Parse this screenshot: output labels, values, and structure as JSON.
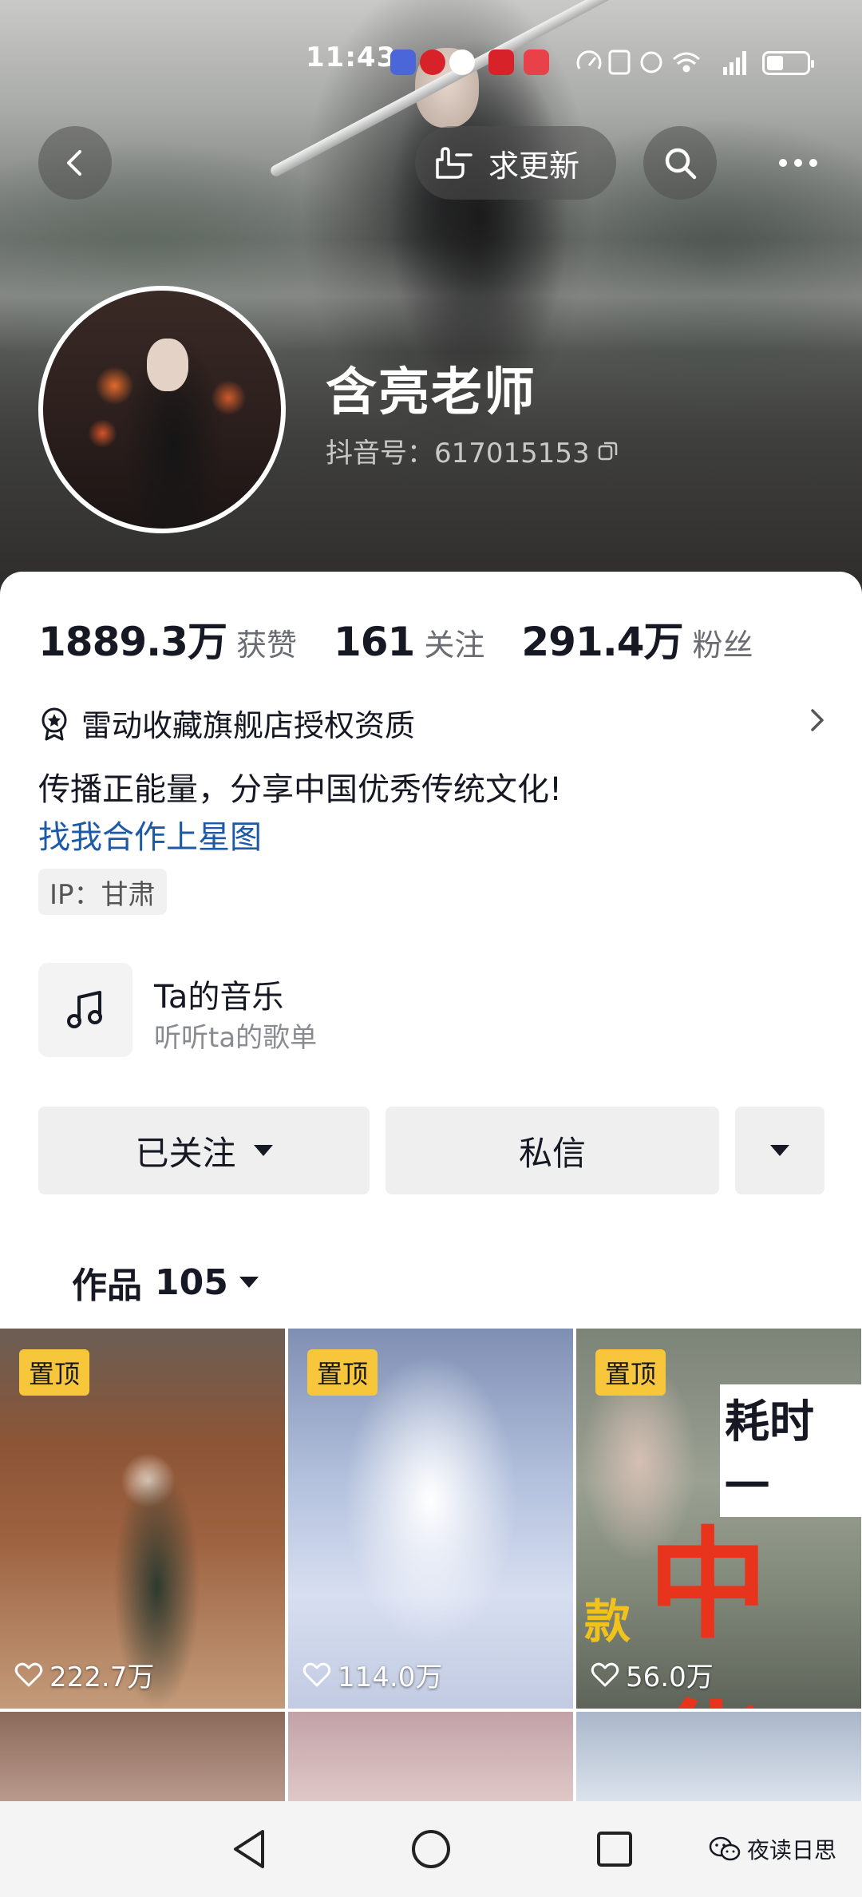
{
  "status_bar": {
    "time": "11:43",
    "app_icon_colors": [
      "#4a66d9",
      "#d8222a",
      "#2f7be6",
      "#d8222a",
      "#e8414a"
    ],
    "icons": [
      "speed-icon",
      "nfc-icon",
      "alarm-icon",
      "wifi-icon",
      "signal-5g-icon",
      "battery-icon"
    ]
  },
  "header": {
    "update_button_label": "求更新",
    "profile_name": "含亮老师",
    "douyin_id": "抖音号：617015153"
  },
  "stats": [
    {
      "value": "1889.3万",
      "label": "获赞"
    },
    {
      "value": "161",
      "label": "关注"
    },
    {
      "value": "291.4万",
      "label": "粉丝"
    }
  ],
  "profile": {
    "verification": "雷动收藏旗舰店授权资质",
    "bio": "传播正能量，分享中国优秀传统文化!",
    "xingtu_link": "找我合作上星图",
    "ip": "IP：甘肃"
  },
  "music": {
    "title": "Ta的音乐",
    "subtitle": "听听ta的歌单"
  },
  "actions": {
    "follow_label": "已关注",
    "message_label": "私信"
  },
  "works": {
    "label": "作品",
    "count": "105"
  },
  "videos": [
    {
      "pinned": "置顶",
      "likes": "222.7万"
    },
    {
      "pinned": "置顶",
      "likes": "114.0万"
    },
    {
      "pinned": "置顶",
      "likes": "56.0万",
      "overlay_top": "耗时一",
      "overlay_mid": "中华",
      "overlay_bottom": "款"
    }
  ],
  "watermark": "夜读日思",
  "colors": {
    "link": "#1c5aa8",
    "pin_badge": "#f7c63a",
    "button_bg": "#efeff0"
  }
}
